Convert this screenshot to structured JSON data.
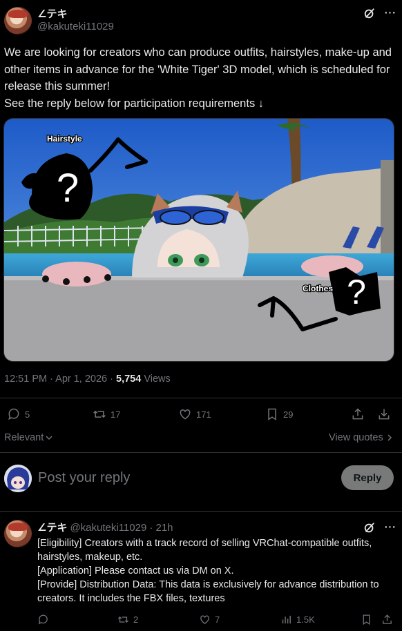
{
  "post": {
    "display_name": "∠テキ",
    "handle": "@kakuteki11029",
    "text_lines": [
      "We are looking for creators who can produce outfits, hairstyles, make-up and other items in advance for the 'White Tiger' 3D model, which is scheduled for release this summer!",
      "See the reply below for participation requirements ↓"
    ],
    "image": {
      "hair_label": "Hairstyle",
      "clothes_label": "Clothes"
    },
    "timestamp": "12:51 PM · Apr 1, 2026 · ",
    "views_count": "5,754",
    "views_label": " Views",
    "stats": {
      "replies": "5",
      "reposts": "17",
      "likes": "171",
      "bookmarks": "29"
    },
    "icons": [
      "grok-icon",
      "more-icon",
      "reply-icon",
      "repost-icon",
      "like-icon",
      "bookmark-icon",
      "share-icon",
      "download-icon"
    ]
  },
  "sort": {
    "label": "Relevant",
    "view_quotes": "View quotes"
  },
  "composer": {
    "placeholder": "Post your reply",
    "button": "Reply"
  },
  "reply": {
    "display_name": "∠テキ",
    "handle": "@kakuteki11029",
    "time": "· 21h",
    "lines": [
      "[Eligibility] Creators with a track record of selling VRChat-compatible outfits, hairstyles, makeup, etc.",
      "[Application] Please contact us via DM on X.",
      "[Provide] Distribution Data: This data is exclusively for advance distribution to creators. It includes the FBX files, textures"
    ],
    "stats": {
      "replies": "",
      "reposts": "2",
      "likes": "7",
      "views": "1.5K"
    }
  },
  "colors": {
    "background": "#000000",
    "text": "#e7e9ea",
    "muted": "#71767b",
    "border": "#2f3336",
    "reply_button": "#787a7a"
  }
}
